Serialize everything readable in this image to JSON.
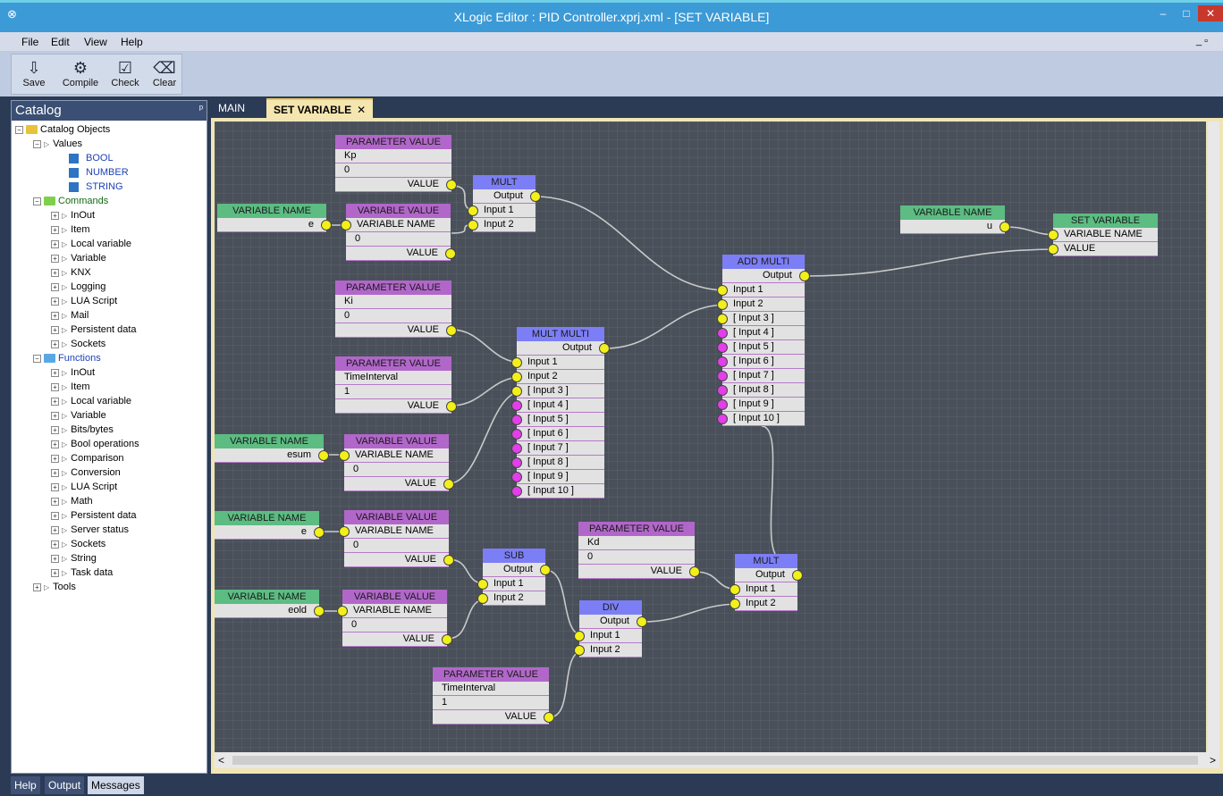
{
  "window": {
    "title": "XLogic Editor : PID Controller.xprj.xml - [SET VARIABLE]",
    "min": "–",
    "max": "□",
    "close": "✕"
  },
  "menu": {
    "items": [
      "File",
      "Edit",
      "View",
      "Help"
    ],
    "restore": "_ ▫"
  },
  "toolbar": {
    "save": "Save",
    "compile": "Compile",
    "check": "Check",
    "clear": "Clear"
  },
  "catalog": {
    "title": "Catalog",
    "pin": "ᵖ",
    "root": "Catalog Objects",
    "values_group": "Values",
    "values": [
      "BOOL",
      "NUMBER",
      "STRING"
    ],
    "commands_group": "Commands",
    "commands": [
      "InOut",
      "Item",
      "Local variable",
      "Variable",
      "KNX",
      "Logging",
      "LUA Script",
      "Mail",
      "Persistent data",
      "Sockets"
    ],
    "functions_group": "Functions",
    "functions": [
      "InOut",
      "Item",
      "Local variable",
      "Variable",
      "Bits/bytes",
      "Bool operations",
      "Comparison",
      "Conversion",
      "LUA Script",
      "Math",
      "Persistent data",
      "Server status",
      "Sockets",
      "String",
      "Task data"
    ],
    "tools": "Tools"
  },
  "tabs": {
    "main": "MAIN",
    "set_variable": "SET VARIABLE",
    "close": "✕"
  },
  "nodes": {
    "pv_kp": {
      "header": "PARAMETER VALUE",
      "name": "Kp",
      "value": "0",
      "out": "VALUE"
    },
    "vn_e1": {
      "header": "VARIABLE NAME",
      "value": "e"
    },
    "vv_e1": {
      "header": "VARIABLE VALUE",
      "in": "VARIABLE NAME",
      "value": "0",
      "out": "VALUE"
    },
    "mult1": {
      "header": "MULT",
      "out": "Output",
      "in1": "Input 1",
      "in2": "Input 2"
    },
    "pv_ki": {
      "header": "PARAMETER VALUE",
      "name": "Ki",
      "value": "0",
      "out": "VALUE"
    },
    "pv_ti1": {
      "header": "PARAMETER VALUE",
      "name": "TimeInterval",
      "value": "1",
      "out": "VALUE"
    },
    "vn_esum": {
      "header": "VARIABLE NAME",
      "value": "esum"
    },
    "vv_esum": {
      "header": "VARIABLE VALUE",
      "in": "VARIABLE NAME",
      "value": "0",
      "out": "VALUE"
    },
    "multmulti": {
      "header": "MULT MULTI",
      "out": "Output",
      "inputs": [
        "Input 1",
        "Input 2",
        "[ Input 3 ]",
        "[ Input 4 ]",
        "[ Input 5 ]",
        "[ Input 6 ]",
        "[ Input 7 ]",
        "[ Input 8 ]",
        "[ Input 9 ]",
        "[ Input 10 ]"
      ]
    },
    "addmulti": {
      "header": "ADD MULTI",
      "out": "Output",
      "inputs": [
        "Input 1",
        "Input 2",
        "[ Input 3 ]",
        "[ Input 4 ]",
        "[ Input 5 ]",
        "[ Input 6 ]",
        "[ Input 7 ]",
        "[ Input 8 ]",
        "[ Input 9 ]",
        "[ Input 10 ]"
      ]
    },
    "vn_u": {
      "header": "VARIABLE NAME",
      "value": "u"
    },
    "setvar": {
      "header": "SET VARIABLE",
      "in1": "VARIABLE NAME",
      "in2": "VALUE"
    },
    "vn_e2": {
      "header": "VARIABLE NAME",
      "value": "e"
    },
    "vv_e2": {
      "header": "VARIABLE VALUE",
      "in": "VARIABLE NAME",
      "value": "0",
      "out": "VALUE"
    },
    "vn_eold": {
      "header": "VARIABLE NAME",
      "value": "eold"
    },
    "vv_eold": {
      "header": "VARIABLE VALUE",
      "in": "VARIABLE NAME",
      "value": "0",
      "out": "VALUE"
    },
    "sub": {
      "header": "SUB",
      "out": "Output",
      "in1": "Input 1",
      "in2": "Input 2"
    },
    "pv_kd": {
      "header": "PARAMETER VALUE",
      "name": "Kd",
      "value": "0",
      "out": "VALUE"
    },
    "mult2": {
      "header": "MULT",
      "out": "Output",
      "in1": "Input 1",
      "in2": "Input 2"
    },
    "div": {
      "header": "DIV",
      "out": "Output",
      "in1": "Input 1",
      "in2": "Input 2"
    },
    "pv_ti2": {
      "header": "PARAMETER VALUE",
      "name": "TimeInterval",
      "value": "1",
      "out": "VALUE"
    }
  },
  "scroll": {
    "left": "<",
    "right": ">"
  },
  "bottom_tabs": [
    "Help",
    "Output",
    "Messages"
  ],
  "colors": {
    "titlebar": "#3c9ad6",
    "param_header": "#b167c9",
    "var_name_header": "#5cbc82",
    "op_header": "#7c7ef5",
    "port_connected": "#f3f019",
    "port_optional": "#e23ee9",
    "canvas": "#49505a"
  }
}
